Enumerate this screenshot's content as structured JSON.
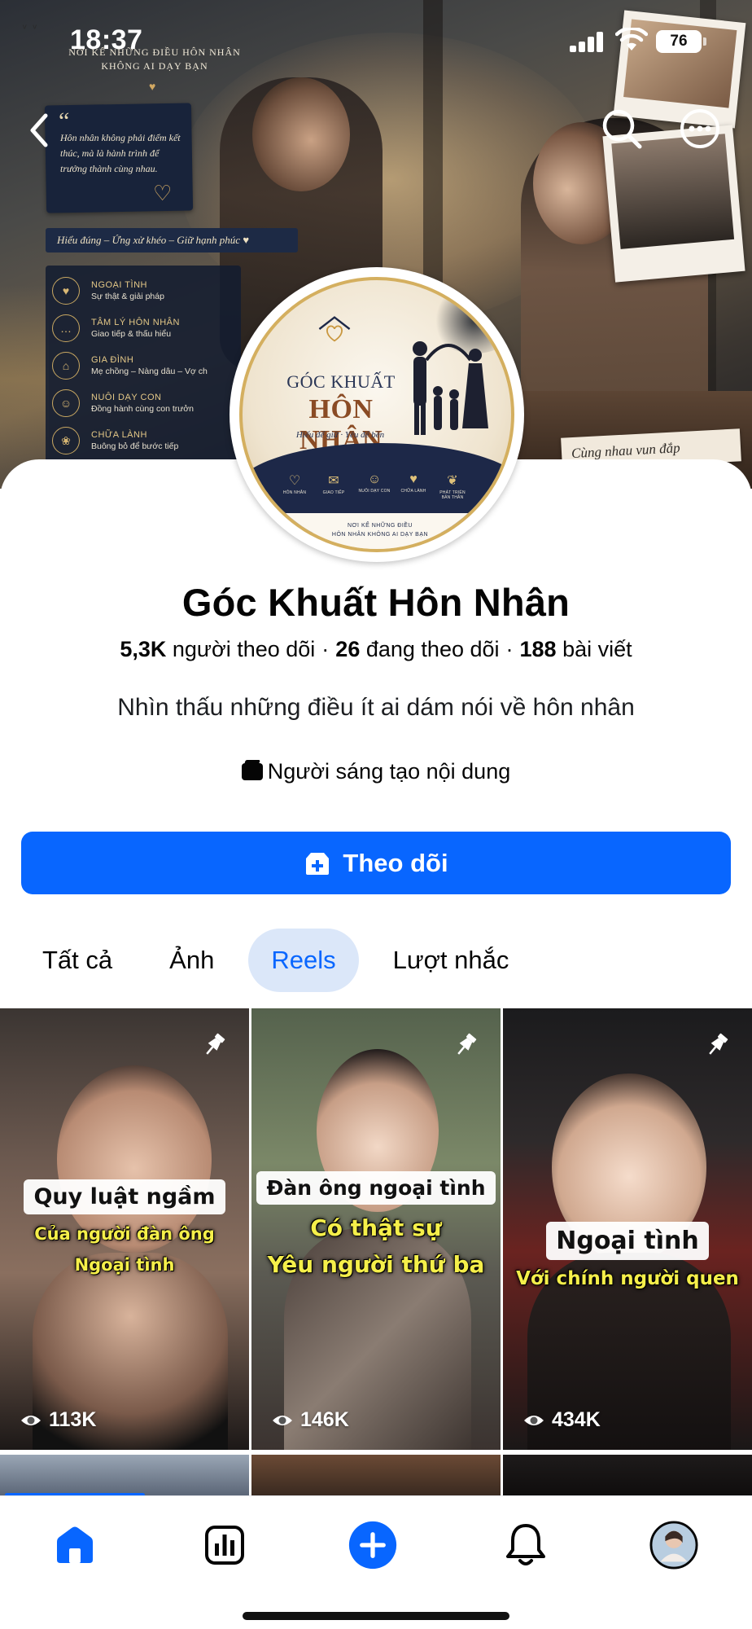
{
  "status_bar": {
    "time": "18:37",
    "battery": "76"
  },
  "cover": {
    "banner_title": "Nơi kể những điều hôn nhân không ai dạy bạn",
    "quote": "Hôn nhân không phải điểm kết thúc, mà là hành trình để trưởng thành cùng nhau.",
    "slogan": "Hiểu đúng – Ứng xử khéo – Giữ hạnh phúc ♥",
    "menu": [
      {
        "title": "Ngoại tình",
        "sub": "Sự thật & giải pháp",
        "icon": "broken-heart-icon"
      },
      {
        "title": "Tâm lý hôn nhân",
        "sub": "Giao tiếp & thấu hiểu",
        "icon": "chat-icon"
      },
      {
        "title": "Gia đình",
        "sub": "Mẹ chồng – Nàng dâu – Vợ ch",
        "icon": "house-heart-icon"
      },
      {
        "title": "Nuôi dạy con",
        "sub": "Đồng hành cùng con trưởn",
        "icon": "family-icon"
      },
      {
        "title": "Chữa lành",
        "sub": "Buông bỏ để bước tiếp",
        "icon": "lotus-icon"
      }
    ],
    "together_note": "Cùng nhau vun đắp"
  },
  "avatar": {
    "line1": "GÓC KHUẤT",
    "line2": "HÔN NHÂN",
    "tagline": "Hiểu để giữ · Yêu để bền",
    "icons": [
      {
        "label": "HÔN NHÂN",
        "glyph": "♡"
      },
      {
        "label": "GIAO TIẾP",
        "glyph": "💬"
      },
      {
        "label": "NUÔI DẠY CON",
        "glyph": "👪"
      },
      {
        "label": "CHỮA LÀNH",
        "glyph": "💔"
      },
      {
        "label": "PHÁT TRIỂN BẢN THÂN",
        "glyph": "🌿"
      }
    ],
    "footer_line1": "Nơi kể những điều",
    "footer_line2": "hôn nhân không ai dạy bạn"
  },
  "profile": {
    "name": "Góc Khuất Hôn Nhân",
    "followers_count": "5,3K",
    "followers_label": "người theo dõi",
    "following_count": "26",
    "following_label": "đang theo dõi",
    "posts_count": "188",
    "posts_label": "bài viết",
    "bio": "Nhìn thấu những điều ít ai dám nói về hôn nhân",
    "category": "Người sáng tạo nội dung",
    "follow_button": "Theo dõi"
  },
  "tabs": [
    {
      "label": "Tất cả",
      "active": false
    },
    {
      "label": "Ảnh",
      "active": false
    },
    {
      "label": "Reels",
      "active": true
    },
    {
      "label": "Lượt nhắc",
      "active": false
    }
  ],
  "reels": [
    {
      "line1": "Quy luật ngầm",
      "line2": "Của người đàn ông",
      "line3": "Ngoại tình",
      "views": "113K",
      "pinned": true
    },
    {
      "line1": "Đàn ông ngoại tình",
      "line2": "Có thật sự",
      "line3": "Yêu người thứ ba",
      "views": "146K",
      "pinned": true
    },
    {
      "line1": "Ngoại tình",
      "line2": "Với chính người quen",
      "line3": "",
      "views": "434K",
      "pinned": true
    }
  ],
  "colors": {
    "accent": "#0866ff",
    "tab_active_bg": "#dbe7f9",
    "text": "#050505"
  },
  "bottom_nav": [
    "home-icon",
    "insights-icon",
    "create-icon",
    "notifications-icon",
    "profile-avatar"
  ]
}
